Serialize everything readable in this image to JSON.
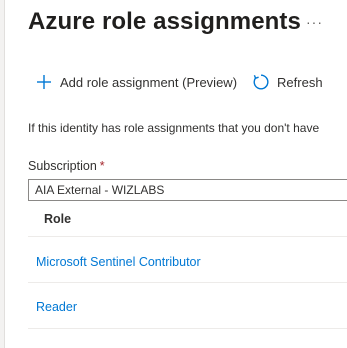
{
  "header": {
    "title": "Azure role assignments",
    "more_icon": "more-ellipsis-icon",
    "more_glyph": "···"
  },
  "toolbar": {
    "add_label": "Add role assignment (Preview)",
    "add_icon": "plus-icon",
    "refresh_label": "Refresh",
    "refresh_icon": "refresh-icon"
  },
  "info": {
    "text": "If this identity has role assignments that you don't have"
  },
  "subscription": {
    "label": "Subscription",
    "required_mark": "*",
    "selected": "AIA External - WIZLABS"
  },
  "table": {
    "columns": [
      "Role"
    ],
    "rows": [
      {
        "role": "Microsoft Sentinel Contributor"
      },
      {
        "role": "Reader"
      }
    ]
  },
  "colors": {
    "link": "#0078d4",
    "required": "#a4262c",
    "text": "#323130"
  }
}
